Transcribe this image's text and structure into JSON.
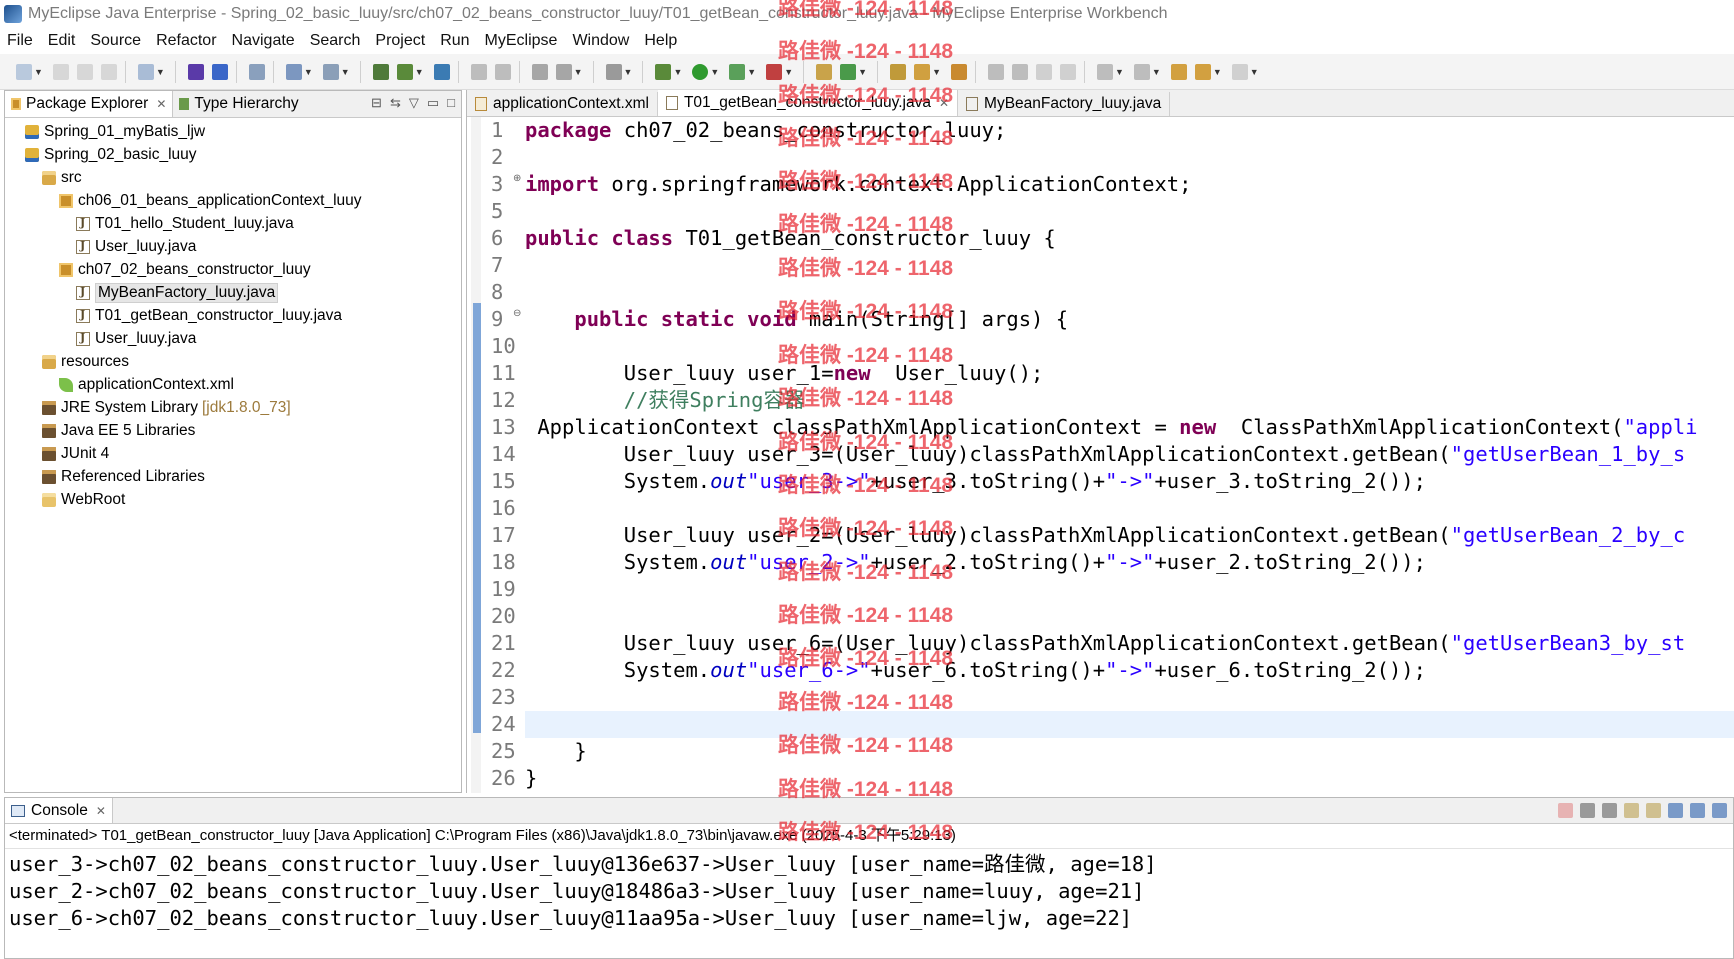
{
  "window": {
    "title": "MyEclipse Java Enterprise - Spring_02_basic_luuy/src/ch07_02_beans_constructor_luuy/T01_getBean_constructor_luuy.java - MyEclipse Enterprise Workbench"
  },
  "menu": [
    "File",
    "Edit",
    "Source",
    "Refactor",
    "Navigate",
    "Search",
    "Project",
    "Run",
    "MyEclipse",
    "Window",
    "Help"
  ],
  "package_explorer": {
    "tabs": [
      "Package Explorer",
      "Type Hierarchy"
    ],
    "tree": [
      {
        "label": "Spring_01_myBatis_ljw",
        "icon": "project-icon",
        "indent": 0
      },
      {
        "label": "Spring_02_basic_luuy",
        "icon": "project-icon",
        "indent": 0
      },
      {
        "label": "src",
        "icon": "source-folder-icon",
        "indent": 1
      },
      {
        "label": "ch06_01_beans_applicationContext_luuy",
        "icon": "package-icon",
        "indent": 2
      },
      {
        "label": "T01_hello_Student_luuy.java",
        "icon": "java-file-icon",
        "indent": 3
      },
      {
        "label": "User_luuy.java",
        "icon": "java-file-icon",
        "indent": 3
      },
      {
        "label": "ch07_02_beans_constructor_luuy",
        "icon": "package-icon",
        "indent": 2
      },
      {
        "label": "MyBeanFactory_luuy.java",
        "icon": "java-file-icon",
        "indent": 3,
        "selected": true
      },
      {
        "label": "T01_getBean_constructor_luuy.java",
        "icon": "java-file-icon",
        "indent": 3
      },
      {
        "label": "User_luuy.java",
        "icon": "java-file-icon",
        "indent": 3
      },
      {
        "label": "resources",
        "icon": "source-folder-icon",
        "indent": 1
      },
      {
        "label": "applicationContext.xml",
        "icon": "xml-leaf-icon",
        "indent": 2
      },
      {
        "label": "JRE System Library",
        "suffix": "[jdk1.8.0_73]",
        "icon": "library-icon",
        "indent": 1
      },
      {
        "label": "Java EE 5 Libraries",
        "icon": "library-icon",
        "indent": 1
      },
      {
        "label": "JUnit 4",
        "icon": "library-icon",
        "indent": 1
      },
      {
        "label": "Referenced Libraries",
        "icon": "library-icon",
        "indent": 1
      },
      {
        "label": "WebRoot",
        "icon": "folder-icon",
        "indent": 1
      }
    ]
  },
  "editor": {
    "tabs": [
      {
        "label": "applicationContext.xml",
        "type": "xml"
      },
      {
        "label": "T01_getBean_constructor_luuy.java",
        "type": "java",
        "active": true
      },
      {
        "label": "MyBeanFactory_luuy.java",
        "type": "java"
      }
    ],
    "lines": [
      {
        "n": "1",
        "segs": [
          [
            "kw",
            "package"
          ],
          [
            "",
            "ch07_02_beans_constructor_luuy;"
          ]
        ]
      },
      {
        "n": "2",
        "segs": []
      },
      {
        "n": "3",
        "segs": [
          [
            "kw",
            "import"
          ],
          [
            "",
            "org.springframework.context.ApplicationContext;"
          ]
        ],
        "fold": "plus"
      },
      {
        "n": "5",
        "segs": []
      },
      {
        "n": "6",
        "segs": [
          [
            "kw",
            "public class"
          ],
          [
            "",
            "T01_getBean_constructor_luuy {"
          ]
        ]
      },
      {
        "n": "7",
        "segs": []
      },
      {
        "n": "8",
        "segs": []
      },
      {
        "n": "9",
        "segs": [
          [
            "",
            "    "
          ],
          [
            "kw",
            "public static void"
          ],
          [
            "",
            "main(String[] args) {"
          ]
        ],
        "fold": "minus"
      },
      {
        "n": "10",
        "segs": []
      },
      {
        "n": "11",
        "segs": [
          [
            "",
            "        User_luuy user_1="
          ],
          [
            "kw",
            "new"
          ],
          [
            "",
            " User_luuy();"
          ]
        ]
      },
      {
        "n": "12",
        "segs": [
          [
            "cmt",
            "        //获得Spring容器"
          ]
        ]
      },
      {
        "n": "13",
        "segs": [
          [
            "",
            " ApplicationContext classPathXmlApplicationContext = "
          ],
          [
            "kw",
            "new"
          ],
          [
            "",
            " ClassPathXmlApplicationContext("
          ],
          [
            "str",
            "\"appli"
          ]
        ]
      },
      {
        "n": "14",
        "segs": [
          [
            "",
            "        User_luuy user_3=(User_luuy)classPathXmlApplicationContext.getBean("
          ],
          [
            "str",
            "\"getUserBean_1_by_s"
          ]
        ]
      },
      {
        "n": "15",
        "segs": [
          [
            "",
            "        System."
          ],
          [
            "fld",
            "out"
          ],
          [
            ".println("
          ],
          [
            "str",
            "\"user_3->\""
          ],
          [
            "",
            "+user_3.toString()+"
          ],
          [
            "str",
            "\"->\""
          ],
          [
            "",
            "+user_3.toString_2());"
          ]
        ]
      },
      {
        "n": "16",
        "segs": []
      },
      {
        "n": "17",
        "segs": [
          [
            "",
            "        User_luuy user_2=(User_luuy)classPathXmlApplicationContext.getBean("
          ],
          [
            "str",
            "\"getUserBean_2_by_c"
          ]
        ]
      },
      {
        "n": "18",
        "segs": [
          [
            "",
            "        System."
          ],
          [
            "fld",
            "out"
          ],
          [
            ".println("
          ],
          [
            "str",
            "\"user_2->\""
          ],
          [
            "",
            "+user_2.toString()+"
          ],
          [
            "str",
            "\"->\""
          ],
          [
            "",
            "+user_2.toString_2());"
          ]
        ]
      },
      {
        "n": "19",
        "segs": []
      },
      {
        "n": "20",
        "segs": []
      },
      {
        "n": "21",
        "segs": [
          [
            "",
            "        User_luuy user_6=(User_luuy)classPathXmlApplicationContext.getBean("
          ],
          [
            "str",
            "\"getUserBean3_by_st"
          ]
        ]
      },
      {
        "n": "22",
        "segs": [
          [
            "",
            "        System."
          ],
          [
            "fld",
            "out"
          ],
          [
            ".println("
          ],
          [
            "str",
            "\"user_6->\""
          ],
          [
            "",
            "+user_6.toString()+"
          ],
          [
            "str",
            "\"->\""
          ],
          [
            "",
            "+user_6.toString_2());"
          ]
        ]
      },
      {
        "n": "23",
        "segs": []
      },
      {
        "n": "24",
        "segs": [],
        "current": true
      },
      {
        "n": "25",
        "segs": [
          [
            "",
            "    }"
          ]
        ]
      },
      {
        "n": "26",
        "segs": [
          [
            "",
            "}"
          ]
        ]
      }
    ]
  },
  "console": {
    "tab": "Console",
    "status": "<terminated> T01_getBean_constructor_luuy [Java Application] C:\\Program Files (x86)\\Java\\jdk1.8.0_73\\bin\\javaw.exe (2025-4-3 下午5:29:13)",
    "output": [
      "user_3->ch07_02_beans_constructor_luuy.User_luuy@136e637->User_luuy [user_name=路佳微, age=18]",
      "user_2->ch07_02_beans_constructor_luuy.User_luuy@18486a3->User_luuy [user_name=luuy, age=21]",
      "user_6->ch07_02_beans_constructor_luuy.User_luuy@11aa95a->User_luuy [user_name=ljw, age=22]"
    ]
  },
  "watermark": "路佳微 -124 - 1148",
  "colors": {
    "keyword": "#7f0055",
    "string": "#2a00ff",
    "comment": "#3f7f5f",
    "field": "#0000c0",
    "watermark": "#e7252f",
    "current_line": "#e8f2fe"
  }
}
